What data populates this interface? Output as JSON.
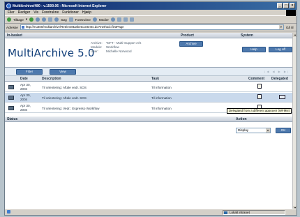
{
  "window": {
    "title": "MultiArchive/480 - v.1500.06 - Microsoft Internet Explorer",
    "controls": [
      "_",
      "□",
      "×"
    ]
  },
  "menubar": [
    "Filer",
    "Rediger",
    "Vis",
    "Foretrukne",
    "Funktioner",
    "Hjælp"
  ],
  "toolbar": {
    "back_label": "Tilbage",
    "search_label": "Søg",
    "favorites_label": "Foretrukne",
    "media_label": "Medier"
  },
  "address": {
    "label": "Adresse",
    "url": "http://mu400/multiarchive/RetrieveBasketContents.do?method=firstPage",
    "go_label": "Gå til"
  },
  "header": {
    "section_left": "In-basket",
    "section_product": "Product",
    "section_system": "System"
  },
  "app": {
    "logo": "MultiArchive 5.0",
    "info": [
      {
        "key": "Archive:",
        "value": "*DFT - Multi-Support A/S"
      },
      {
        "key": "Module:",
        "value": "Workflow"
      },
      {
        "key": "User:",
        "value": "Michelle Norwood"
      }
    ],
    "archive_button": "Archive",
    "help_button": "Help",
    "logoff_button": "Log off"
  },
  "filterbar": {
    "filter_button": "Filter",
    "view_button": "View",
    "pager": "|◀ ◀ ▶ ▶|"
  },
  "table": {
    "columns": {
      "date": "Date",
      "description": "Description",
      "task": "Task",
      "comment": "Comment",
      "delegated": "Delegated"
    },
    "rows": [
      {
        "date": "Apr 30, 2004",
        "description": "Til orientering: Aftale vedr. SOS",
        "task": "Til information"
      },
      {
        "date": "Apr 30, 2004",
        "description": "Til orientering: Aftale vedr. SOS",
        "task": "Til information"
      },
      {
        "date": "Apr 30, 2004",
        "description": "Til orientering: Vedr.: Espresso Workflow",
        "task": "Til information"
      }
    ]
  },
  "tooltip": "Delegated from a different approver (WFMN)",
  "status_section": {
    "label": "Status",
    "action_label": "Action",
    "selected_action": "Display",
    "ok_button": "OK"
  },
  "ie_status": {
    "zone": "Lokalt intranet"
  },
  "colors": {
    "accent": "#4e79ad",
    "logo": "#0f3d78",
    "selected_row": "#c9d9ec"
  }
}
